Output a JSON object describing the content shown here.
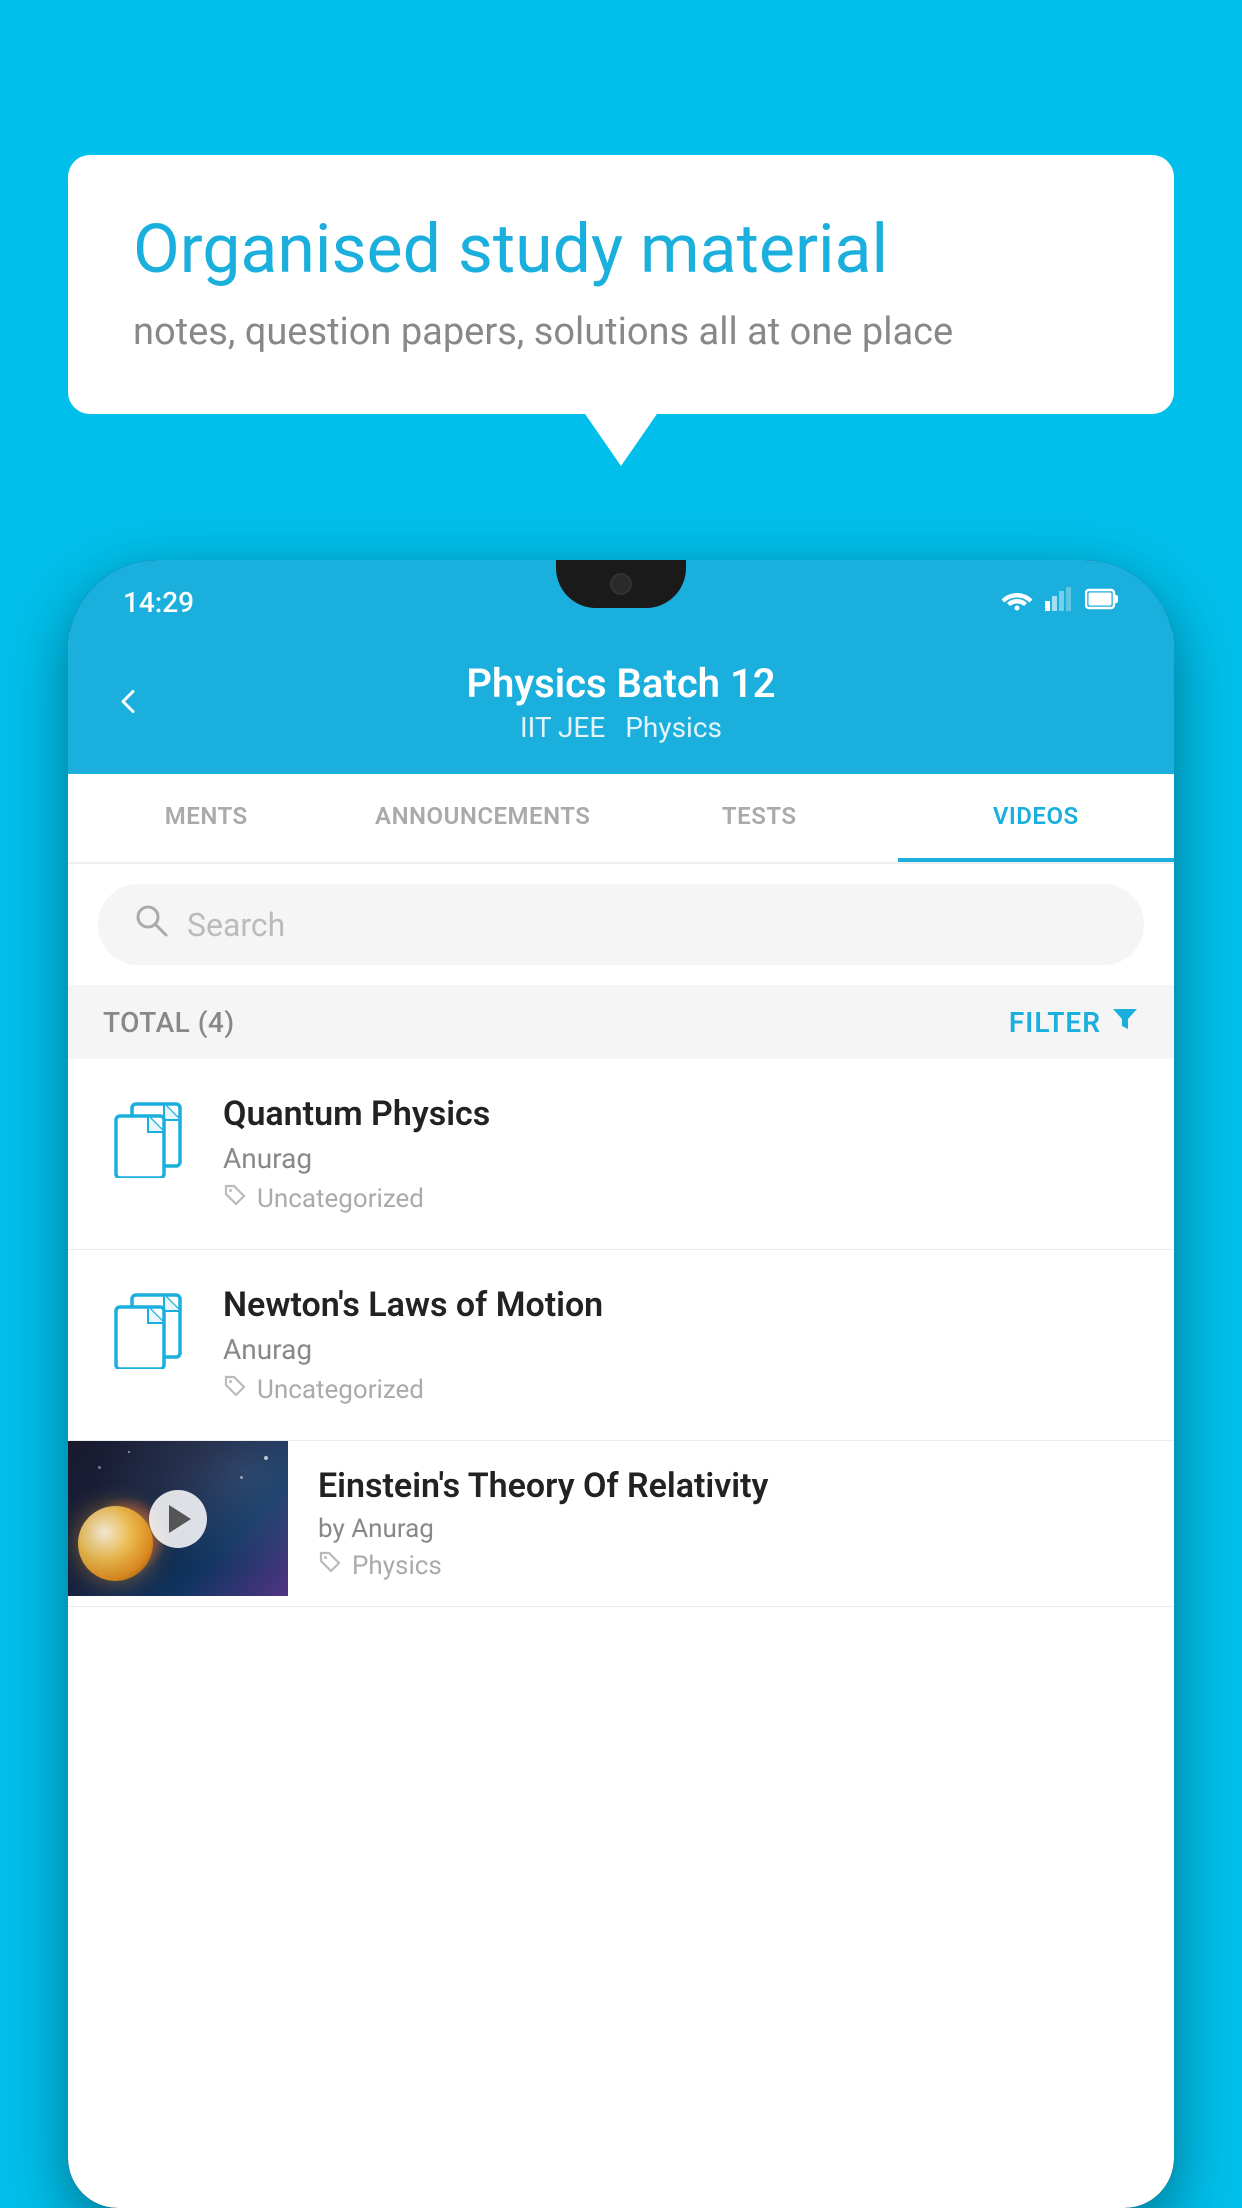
{
  "page": {
    "background_color": "#00BFEA"
  },
  "speech_bubble": {
    "headline": "Organised study material",
    "subtext": "notes, question papers, solutions all at one place"
  },
  "status_bar": {
    "time": "14:29",
    "wifi": "▼",
    "signal": "▲",
    "battery": "█"
  },
  "app_header": {
    "back_label": "←",
    "title": "Physics Batch 12",
    "subtitle_part1": "IIT JEE",
    "subtitle_part2": "Physics"
  },
  "tabs": [
    {
      "label": "MENTS",
      "active": false
    },
    {
      "label": "ANNOUNCEMENTS",
      "active": false
    },
    {
      "label": "TESTS",
      "active": false
    },
    {
      "label": "VIDEOS",
      "active": true
    }
  ],
  "search": {
    "placeholder": "Search"
  },
  "filter_bar": {
    "total_label": "TOTAL (4)",
    "filter_label": "FILTER"
  },
  "video_items": [
    {
      "title": "Quantum Physics",
      "author": "Anurag",
      "tag": "Uncategorized",
      "type": "folder"
    },
    {
      "title": "Newton's Laws of Motion",
      "author": "Anurag",
      "tag": "Uncategorized",
      "type": "folder"
    },
    {
      "title": "Einstein's Theory Of Relativity",
      "author": "by Anurag",
      "tag": "Physics",
      "type": "video"
    }
  ]
}
